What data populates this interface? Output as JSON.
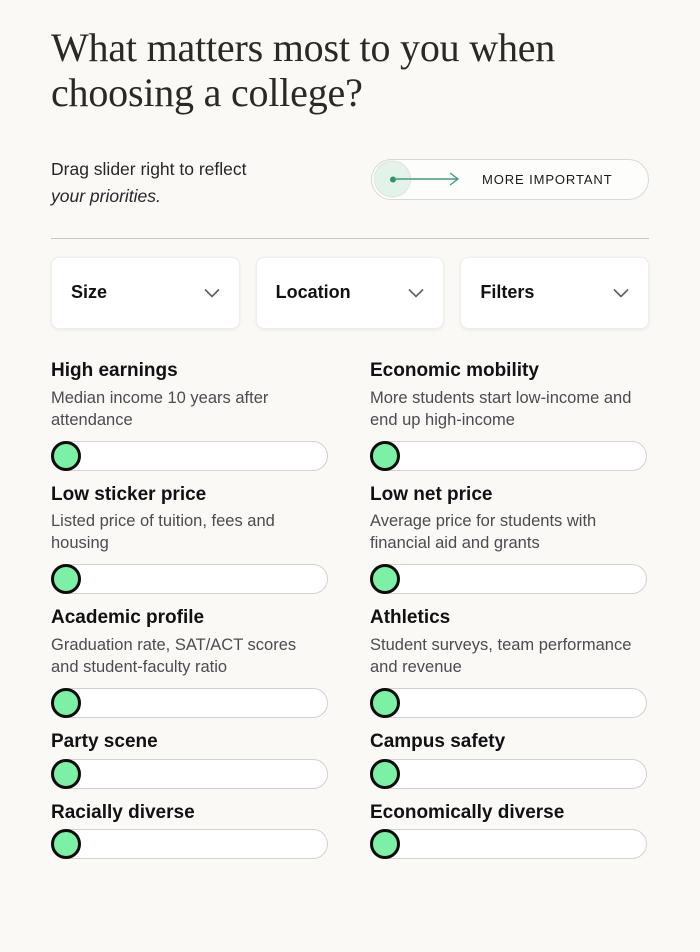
{
  "header": {
    "title": "What matters most to you when choosing a college?"
  },
  "intro": {
    "line1": "Drag slider right to reflect",
    "line2": "your priorities.",
    "hint": {
      "label": "MORE IMPORTANT",
      "knob_icon": "slider-knob-icon",
      "arrow_icon": "arrow-right-icon"
    }
  },
  "filters": [
    {
      "label": "Size",
      "icon": "chevron-down-icon"
    },
    {
      "label": "Location",
      "icon": "chevron-down-icon"
    },
    {
      "label": "Filters",
      "icon": "chevron-down-icon"
    }
  ],
  "sliders": [
    {
      "title": "High earnings",
      "desc": "Median income 10 years after attendance",
      "value": 0
    },
    {
      "title": "Economic mobility",
      "desc": "More students start low-income and end up high-income",
      "value": 0
    },
    {
      "title": "Low sticker price",
      "desc": "Listed price of tuition, fees and housing",
      "value": 0
    },
    {
      "title": "Low net price",
      "desc": "Average price for students with financial aid and grants",
      "value": 0
    },
    {
      "title": "Academic profile",
      "desc": "Graduation rate, SAT/ACT scores and student-faculty ratio",
      "value": 0
    },
    {
      "title": "Athletics",
      "desc": "Student surveys, team performance and revenue",
      "value": 0
    },
    {
      "title": "Party scene",
      "desc": "",
      "value": 0
    },
    {
      "title": "Campus safety",
      "desc": "",
      "value": 0
    },
    {
      "title": "Racially diverse",
      "desc": "",
      "value": 0
    },
    {
      "title": "Economically diverse",
      "desc": "",
      "value": 0
    }
  ],
  "colors": {
    "background": "#faf9f6",
    "thumb_green": "#7cf0a5",
    "thumb_ring": "#0b0b0b",
    "hint_green": "#e4f3ea",
    "arrow_teal": "#3f9c7b",
    "track_border": "#d2d1cd"
  }
}
